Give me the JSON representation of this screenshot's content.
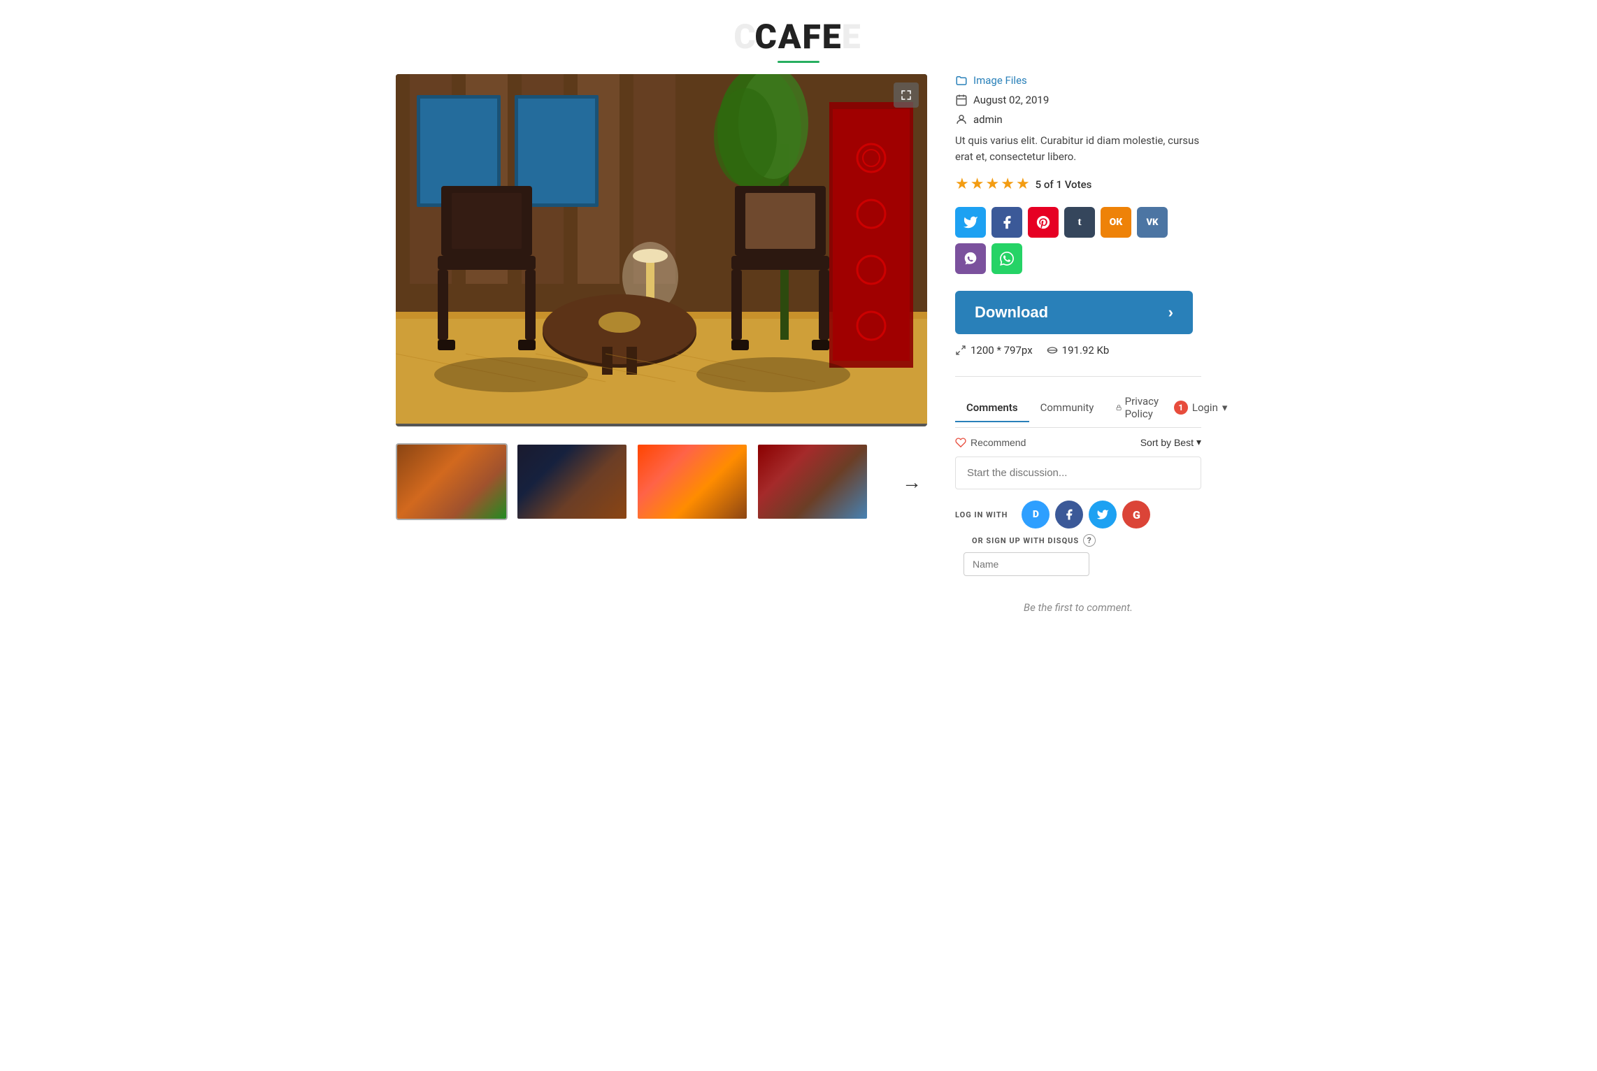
{
  "header": {
    "logo_bg_left": "C",
    "logo_main": "CAFE",
    "logo_bg_right": "E",
    "underline_color": "#27ae60"
  },
  "meta": {
    "category": "Image Files",
    "date": "August 02, 2019",
    "author": "admin",
    "description": "Ut quis varius elit. Curabitur id diam molestie, cursus erat et, consectetur libero.",
    "rating_value": "5",
    "rating_count": "1",
    "rating_label": "5 of 1 Votes"
  },
  "social": {
    "buttons": [
      "Twitter",
      "Facebook",
      "Pinterest",
      "Tumblr",
      "OK",
      "VK",
      "Viber",
      "WhatsApp"
    ]
  },
  "download": {
    "label": "Download",
    "arrow": "›",
    "dimensions": "1200 * 797px",
    "filesize": "191.92 Kb"
  },
  "comments": {
    "tab_comments": "Comments",
    "tab_community": "Community",
    "tab_privacy": "Privacy Policy",
    "tab_login": "Login",
    "login_badge": "1",
    "recommend_label": "Recommend",
    "sort_label": "Sort by Best",
    "discussion_placeholder": "Start the discussion...",
    "login_label": "LOG IN WITH",
    "signup_label": "OR SIGN UP WITH DISQUS",
    "name_placeholder": "Name",
    "first_comment": "Be the first to comment."
  },
  "thumbnails": [
    {
      "id": 1,
      "active": true
    },
    {
      "id": 2,
      "active": false
    },
    {
      "id": 3,
      "active": false
    },
    {
      "id": 4,
      "active": false
    }
  ],
  "expand_icon": "⛶"
}
